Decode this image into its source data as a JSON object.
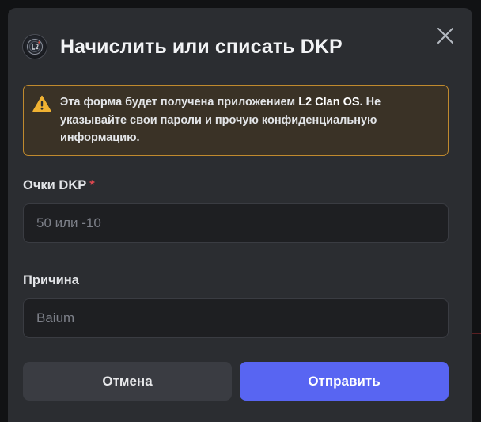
{
  "dialog": {
    "title": "Начислить или списать DKP",
    "logo_icon": "l2-clan-logo-icon",
    "close_icon": "close-icon"
  },
  "notice": {
    "icon": "warning-icon",
    "text_before": "Эта форма будет получена приложением ",
    "app_name": "L2 Clan OS",
    "text_after": ". Не указывайте свои пароли и прочую конфиденциальную информацию.",
    "border_color": "#c08a2e"
  },
  "fields": {
    "points": {
      "label": "Очки DKP",
      "required_mark": "*",
      "value": "",
      "placeholder": "50 или -10"
    },
    "reason": {
      "label": "Причина",
      "value": "",
      "placeholder": "Baium"
    }
  },
  "buttons": {
    "cancel_label": "Отмена",
    "submit_label": "Отправить",
    "submit_color": "#5865f2"
  }
}
